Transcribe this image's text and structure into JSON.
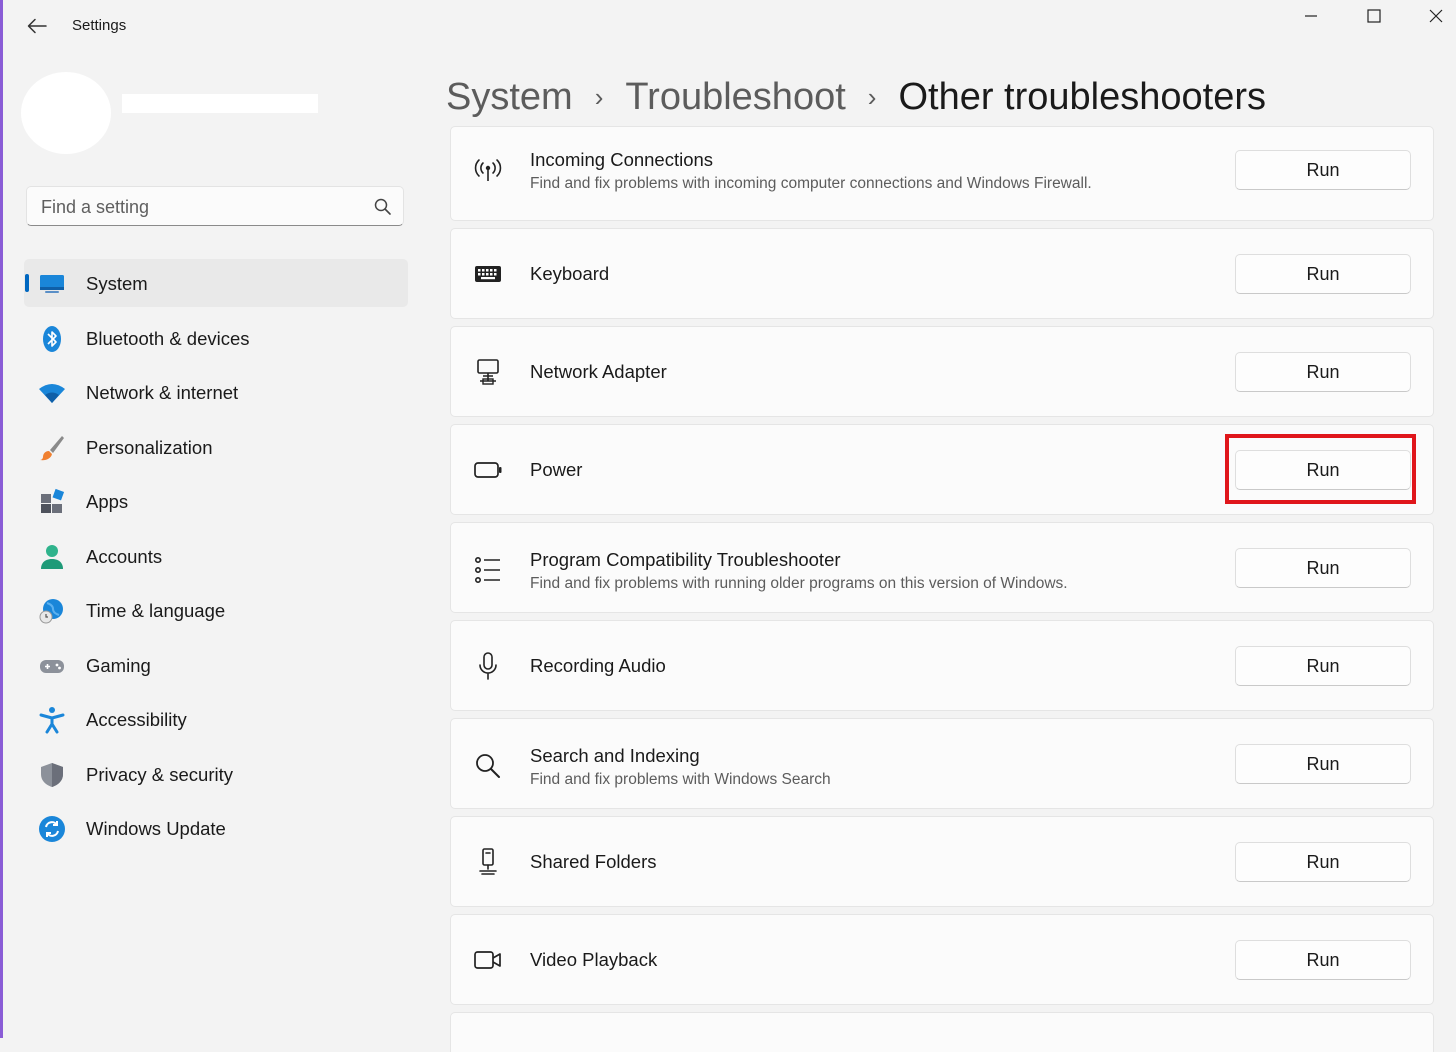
{
  "window": {
    "title": "Settings",
    "controls": [
      "minimize",
      "maximize",
      "close"
    ]
  },
  "sidebar": {
    "search_placeholder": "Find a setting",
    "items": [
      {
        "label": "System",
        "icon": "system-icon",
        "active": true
      },
      {
        "label": "Bluetooth & devices",
        "icon": "bluetooth-icon"
      },
      {
        "label": "Network & internet",
        "icon": "wifi-icon"
      },
      {
        "label": "Personalization",
        "icon": "brush-icon"
      },
      {
        "label": "Apps",
        "icon": "apps-icon"
      },
      {
        "label": "Accounts",
        "icon": "person-icon"
      },
      {
        "label": "Time & language",
        "icon": "globe-clock-icon"
      },
      {
        "label": "Gaming",
        "icon": "gamepad-icon"
      },
      {
        "label": "Accessibility",
        "icon": "accessibility-icon"
      },
      {
        "label": "Privacy & security",
        "icon": "shield-icon"
      },
      {
        "label": "Windows Update",
        "icon": "update-icon"
      }
    ]
  },
  "breadcrumb": {
    "items": [
      "System",
      "Troubleshoot"
    ],
    "separator": "›",
    "current": "Other troubleshooters"
  },
  "troubleshooters": [
    {
      "title": "Incoming Connections",
      "description": "Find and fix problems with incoming computer connections and Windows Firewall.",
      "button": "Run",
      "icon": "antenna-icon"
    },
    {
      "title": "Keyboard",
      "description": "",
      "button": "Run",
      "icon": "keyboard-icon"
    },
    {
      "title": "Network Adapter",
      "description": "",
      "button": "Run",
      "icon": "network-adapter-icon"
    },
    {
      "title": "Power",
      "description": "",
      "button": "Run",
      "icon": "battery-icon",
      "highlighted": true
    },
    {
      "title": "Program Compatibility Troubleshooter",
      "description": "Find and fix problems with running older programs on this version of Windows.",
      "button": "Run",
      "icon": "list-icon"
    },
    {
      "title": "Recording Audio",
      "description": "",
      "button": "Run",
      "icon": "microphone-icon"
    },
    {
      "title": "Search and Indexing",
      "description": "Find and fix problems with Windows Search",
      "button": "Run",
      "icon": "search-icon"
    },
    {
      "title": "Shared Folders",
      "description": "",
      "button": "Run",
      "icon": "shared-folder-icon"
    },
    {
      "title": "Video Playback",
      "description": "",
      "button": "Run",
      "icon": "video-icon"
    }
  ],
  "colors": {
    "accent": "#0067c0",
    "highlight": "#e0161b",
    "background": "#f3f3f3"
  }
}
